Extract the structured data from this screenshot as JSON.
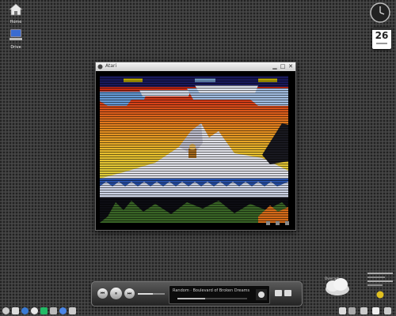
{
  "desktop": {
    "icons": [
      {
        "label": "Home"
      },
      {
        "label": "Drive"
      }
    ]
  },
  "calendar": {
    "day": "26"
  },
  "window": {
    "title": "Atari"
  },
  "player": {
    "now_playing": "Random · Boulevard of Broken Dreams",
    "progress": 0.4,
    "volume": 0.55
  },
  "weather": {
    "label": "Overcast"
  },
  "colors": {
    "accent": "#c8b400",
    "sky_top": "#d01010",
    "water": "#1a4aa0"
  }
}
